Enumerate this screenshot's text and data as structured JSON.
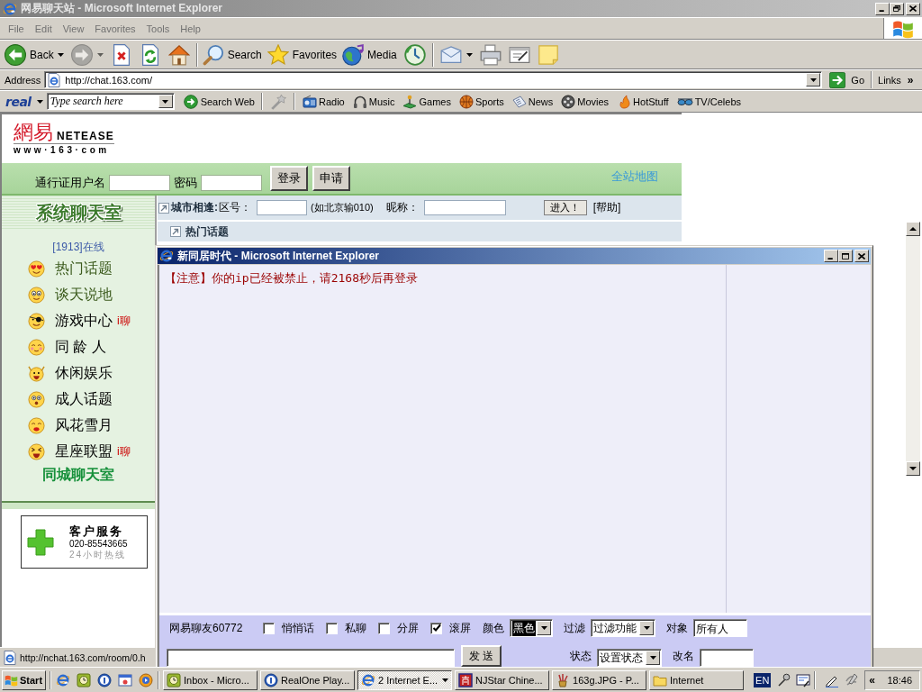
{
  "browser": {
    "title": "网易聊天站 - Microsoft Internet Explorer",
    "menu": [
      "File",
      "Edit",
      "View",
      "Favorites",
      "Tools",
      "Help"
    ],
    "toolbar": [
      [
        {
          "kind": "back",
          "label": "Back",
          "dropdown": true,
          "disabled": false
        },
        {
          "kind": "forward",
          "dropdown": true,
          "disabled": true
        },
        {
          "kind": "stop",
          "dropdown": false,
          "disabled": false
        },
        {
          "kind": "refresh",
          "dropdown": false,
          "disabled": false
        },
        {
          "kind": "home",
          "dropdown": false,
          "disabled": false
        }
      ],
      [
        {
          "kind": "search",
          "label": "Search",
          "dropdown": false,
          "disabled": false
        },
        {
          "kind": "favorites",
          "label": "Favorites",
          "dropdown": false,
          "disabled": false
        },
        {
          "kind": "media",
          "label": "Media",
          "dropdown": false,
          "disabled": false
        },
        {
          "kind": "history",
          "dropdown": false,
          "disabled": false
        }
      ],
      [
        {
          "kind": "mail",
          "dropdown": true,
          "disabled": false
        },
        {
          "kind": "print",
          "dropdown": false,
          "disabled": false
        },
        {
          "kind": "edit",
          "dropdown": false,
          "disabled": false
        },
        {
          "kind": "note",
          "dropdown": false,
          "disabled": false
        }
      ]
    ],
    "address": {
      "label": "Address",
      "value": "http://chat.163.com/",
      "go": "Go",
      "links": "Links",
      "more": "»"
    },
    "realbar": {
      "logo": "real",
      "placeholder": "Type search here",
      "search": "Search Web",
      "links": [
        {
          "kind": "radio",
          "label": "Radio"
        },
        {
          "kind": "music",
          "label": "Music"
        },
        {
          "kind": "games",
          "label": "Games"
        },
        {
          "kind": "sports",
          "label": "Sports"
        },
        {
          "kind": "news",
          "label": "News"
        },
        {
          "kind": "movies",
          "label": "Movies"
        },
        {
          "kind": "hotstuff",
          "label": "HotStuff"
        },
        {
          "kind": "celebs",
          "label": "TV/Celebs"
        }
      ]
    },
    "status": "http://nchat.163.com/room/0.h"
  },
  "page": {
    "logo": {
      "mark": "網易",
      "name": "NETEASE",
      "site": "www·163·com"
    },
    "login": {
      "user_label": "通行证用户名",
      "password_label": "密码",
      "buttons": [
        "登录",
        "申请"
      ],
      "sitemap": "全站地图"
    },
    "sidebar": {
      "heading": "系统聊天室",
      "online": "[1913]在线",
      "rooms": [
        {
          "kind": "hearteyes",
          "name": "热门话题",
          "color": "#3b5a1c"
        },
        {
          "kind": "smile",
          "name": "谈天说地",
          "color": "#3b5a1c"
        },
        {
          "kind": "eyepatch",
          "name": "游戏中心",
          "color": "#000000",
          "tag": "i聊"
        },
        {
          "kind": "blush",
          "name": "同 龄 人",
          "color": "#000000"
        },
        {
          "kind": "cheer",
          "name": "休闲娱乐",
          "color": "#000000"
        },
        {
          "kind": "surprised",
          "name": "成人话题",
          "color": "#000000"
        },
        {
          "kind": "kiss",
          "name": "风花雪月",
          "color": "#000000"
        },
        {
          "kind": "laugh",
          "name": "星座联盟",
          "color": "#000000",
          "tag": "i聊"
        }
      ],
      "city_rooms": "同城聊天室"
    },
    "service": {
      "title": "客户服务",
      "phone": "020-85543665",
      "hours": "24小时热线"
    },
    "citybar": {
      "title": "城市相逢:",
      "area_label": "区号：",
      "area_hint": "(如北京输010)",
      "nick_label": "昵称：",
      "enter": "进入！",
      "help": "[帮助]"
    },
    "hot_topics": "热门话题"
  },
  "popup": {
    "title": "新同居时代 - Microsoft Internet Explorer",
    "message": "【注意】你的ip已经被禁止，请2168秒后再登录",
    "user": "网易聊友60772",
    "options": [
      {
        "label": "悄悄话",
        "checked": false
      },
      {
        "label": "私聊",
        "checked": false
      },
      {
        "label": "分屏",
        "checked": false
      },
      {
        "label": "滚屏",
        "checked": true
      }
    ],
    "color": {
      "label": "颜色",
      "value": "黑色"
    },
    "filter": {
      "label": "过滤",
      "value": "过滤功能"
    },
    "target": {
      "label": "对象",
      "value": "所有人"
    },
    "send": "发 送",
    "status": {
      "label": "状态",
      "value": "设置状态"
    },
    "rename": {
      "label": "改名"
    }
  },
  "taskbar": {
    "start": "Start",
    "tasks": [
      {
        "kind": "inbox",
        "label": "Inbox - Micro...",
        "selected": false,
        "dropdown": false
      },
      {
        "kind": "player",
        "label": "RealOne Play...",
        "selected": false,
        "dropdown": false
      },
      {
        "kind": "browser",
        "label": "2 Internet E...",
        "selected": true,
        "dropdown": true
      },
      {
        "kind": "tile",
        "label": "NJStar Chine...",
        "selected": false,
        "dropdown": false
      },
      {
        "kind": "brushes",
        "label": "163g.JPG - P...",
        "selected": false,
        "dropdown": false
      },
      {
        "kind": "folder",
        "label": "Internet",
        "selected": false,
        "dropdown": false
      }
    ],
    "language": "EN",
    "expand": "«",
    "clock": "18:46"
  }
}
